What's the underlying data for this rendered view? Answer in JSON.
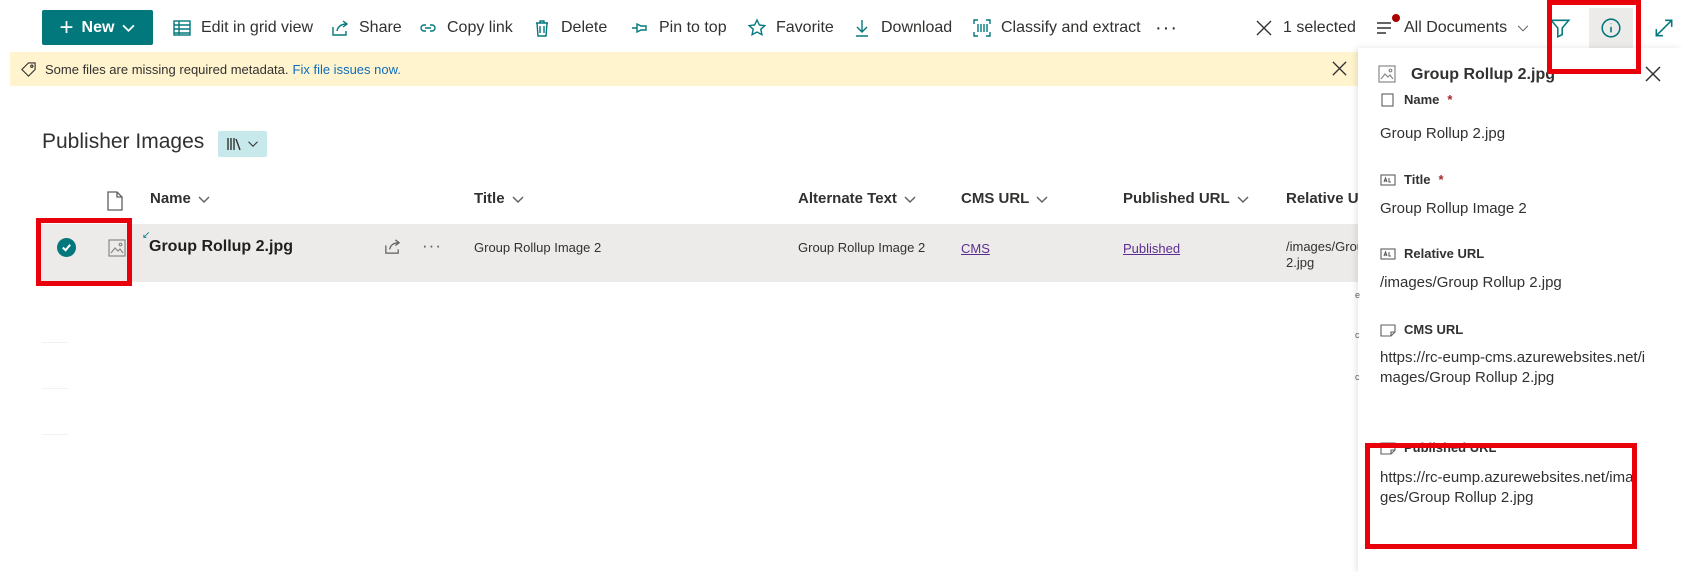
{
  "toolbar": {
    "new_label": "New",
    "edit_grid": "Edit in grid view",
    "share": "Share",
    "copy_link": "Copy link",
    "delete": "Delete",
    "pin": "Pin to top",
    "favorite": "Favorite",
    "download": "Download",
    "classify": "Classify and extract",
    "more": "···",
    "selected": "1 selected",
    "view": "All Documents"
  },
  "banner": {
    "text": "Some files are missing required metadata.",
    "link": "Fix file issues now."
  },
  "library": {
    "title": "Publisher Images"
  },
  "columns": {
    "name": "Name",
    "title": "Title",
    "alt": "Alternate Text",
    "cms": "CMS URL",
    "published": "Published URL",
    "relative": "Relative URL"
  },
  "row": {
    "name": "Group Rollup 2.jpg",
    "title": "Group Rollup Image 2",
    "alt": "Group Rollup Image 2",
    "cms": "CMS",
    "published": "Published",
    "relative_1": "/images/Group Rollup",
    "relative_2": "2.jpg",
    "more": "···"
  },
  "pane": {
    "title": "Group Rollup 2.jpg",
    "fields": [
      {
        "label": "Name",
        "required": "*",
        "value": "Group Rollup 2.jpg"
      },
      {
        "label": "Title",
        "required": "*",
        "value": "Group Rollup Image 2"
      },
      {
        "label": "Relative URL",
        "value": "/images/Group Rollup 2.jpg"
      },
      {
        "label": "CMS URL",
        "value": "https://rc-eump-cms.azurewebsites.net/images/Group Rollup 2.jpg"
      },
      {
        "label": "Published URL",
        "value": "https://rc-eump.azurewebsites.net/images/Group Rollup 2.jpg"
      }
    ]
  },
  "colors": {
    "accent": "#03787c",
    "banner_bg": "#fff4ce",
    "selected_row": "#edebe9",
    "highlight": "#e8000b"
  }
}
